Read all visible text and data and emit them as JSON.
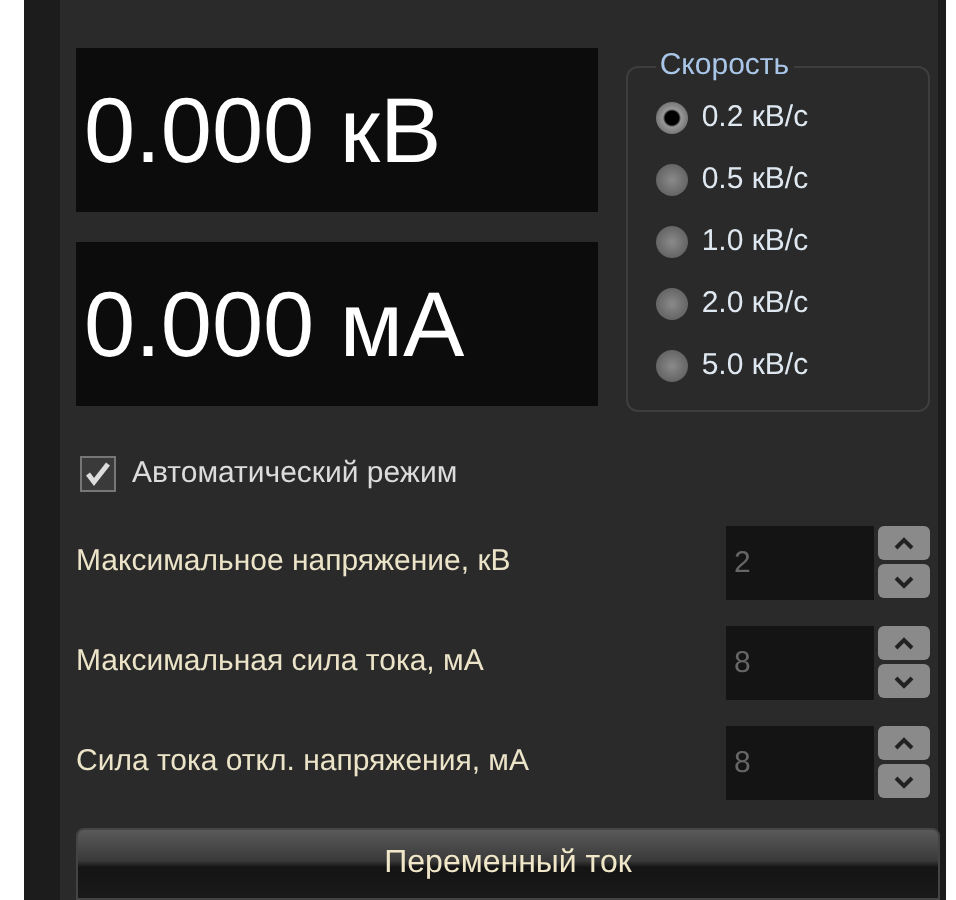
{
  "displays": [
    {
      "value": "0.000 кВ"
    },
    {
      "value": "0.000 мА"
    }
  ],
  "speed": {
    "title": "Скорость",
    "options": [
      {
        "label": "0.2 кВ/с",
        "selected": true
      },
      {
        "label": "0.5 кВ/с",
        "selected": false
      },
      {
        "label": "1.0 кВ/с",
        "selected": false
      },
      {
        "label": "2.0 кВ/с",
        "selected": false
      },
      {
        "label": "5.0 кВ/с",
        "selected": false
      }
    ]
  },
  "auto_mode": {
    "label": "Автоматический режим",
    "checked": true
  },
  "settings": [
    {
      "label": "Максимальное напряжение, кВ",
      "value": "2",
      "disabled": true
    },
    {
      "label": "Максимальная сила тока, мА",
      "value": "8",
      "disabled": true
    },
    {
      "label": "Сила тока откл. напряжения, мА",
      "value": "8",
      "disabled": true
    }
  ],
  "mode_button": {
    "label": "Переменный ток"
  }
}
